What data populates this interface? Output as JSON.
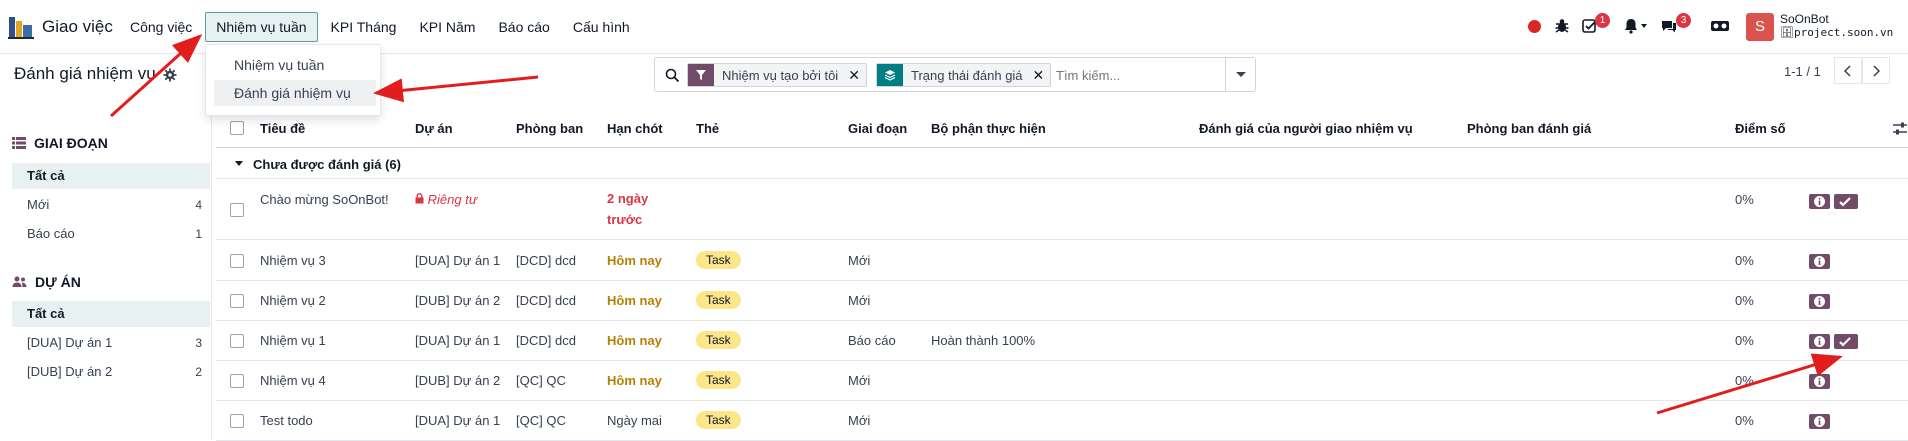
{
  "app": {
    "name": "Giao việc"
  },
  "menu": [
    {
      "label": "Công việc"
    },
    {
      "label": "Nhiệm vụ tuần"
    },
    {
      "label": "KPI Tháng"
    },
    {
      "label": "KPI Năm"
    },
    {
      "label": "Báo cáo"
    },
    {
      "label": "Cấu hình"
    }
  ],
  "dropdown": {
    "items": [
      {
        "label": "Nhiệm vụ tuần"
      },
      {
        "label": "Đánh giá nhiệm vụ"
      }
    ]
  },
  "systray": {
    "activity_badge": "1",
    "chat_badge": "3",
    "avatar_letter": "S",
    "user_name": "SoOnBot",
    "database": "project.soon.vn"
  },
  "breadcrumb": {
    "title": "Đánh giá nhiệm vụ"
  },
  "search": {
    "facets": [
      {
        "label": "Nhiệm vụ tạo bởi tôi",
        "icon": "filter-icon"
      },
      {
        "label": "Trạng thái đánh giá",
        "icon": "layers-icon"
      }
    ],
    "placeholder": "Tìm kiếm..."
  },
  "pager": {
    "value": "1-1 / 1"
  },
  "sidebar": {
    "stage": {
      "heading": "GIAI ĐOẠN",
      "items": [
        {
          "label": "Tất cả",
          "count": ""
        },
        {
          "label": "Mới",
          "count": "4"
        },
        {
          "label": "Báo cáo",
          "count": "1"
        }
      ]
    },
    "project": {
      "heading": "DỰ ÁN",
      "items": [
        {
          "label": "Tất cả",
          "count": ""
        },
        {
          "label": "[DUA] Dự án 1",
          "count": "3"
        },
        {
          "label": "[DUB] Dự án 2",
          "count": "2"
        }
      ]
    }
  },
  "columns": {
    "title": "Tiêu đề",
    "project": "Dự án",
    "department": "Phòng ban",
    "deadline": "Hạn chót",
    "tags": "Thẻ",
    "stage": "Giai đoạn",
    "unit": "Bộ phận thực hiện",
    "assigner_eval": "Đánh giá của người giao nhiệm vụ",
    "eval_dept": "Phòng ban đánh giá",
    "score": "Điểm số"
  },
  "group": {
    "label": "Chưa được đánh giá (6)"
  },
  "rows": [
    {
      "title": "Chào mừng SoOnBot!",
      "project": "Riêng tư",
      "department": "",
      "deadline_line1": "2 ngày",
      "deadline_line2": "trước",
      "tag": "",
      "stage": "",
      "unit": "",
      "score": "0%"
    },
    {
      "title": "Nhiệm vụ 3",
      "project": "[DUA] Dự án 1",
      "department": "[DCD] dcd",
      "deadline": "Hôm nay",
      "tag": "Task",
      "stage": "Mới",
      "unit": "",
      "score": "0%"
    },
    {
      "title": "Nhiệm vụ 2",
      "project": "[DUB] Dự án 2",
      "department": "[DCD] dcd",
      "deadline": "Hôm nay",
      "tag": "Task",
      "stage": "Mới",
      "unit": "",
      "score": "0%"
    },
    {
      "title": "Nhiệm vụ 1",
      "project": "[DUA] Dự án 1",
      "department": "[DCD] dcd",
      "deadline": "Hôm nay",
      "tag": "Task",
      "stage": "Báo cáo",
      "unit": "Hoàn thành 100%",
      "score": "0%"
    },
    {
      "title": "Nhiệm vụ 4",
      "project": "[DUB] Dự án 2",
      "department": "[QC] QC",
      "deadline": "Hôm nay",
      "tag": "Task",
      "stage": "Mới",
      "unit": "",
      "score": "0%"
    },
    {
      "title": "Test todo",
      "project": "[DUA] Dự án 1",
      "department": "[QC] QC",
      "deadline": "Ngày mai",
      "tag": "Task",
      "stage": "Mới",
      "unit": "",
      "score": "0%"
    }
  ],
  "colors": {
    "accent": "#714b67",
    "highlight": "#e7f1f2",
    "danger": "#dc3545",
    "warning": "#b58105",
    "tag_bg": "#fde68a",
    "annotation": "#e11d1d"
  }
}
